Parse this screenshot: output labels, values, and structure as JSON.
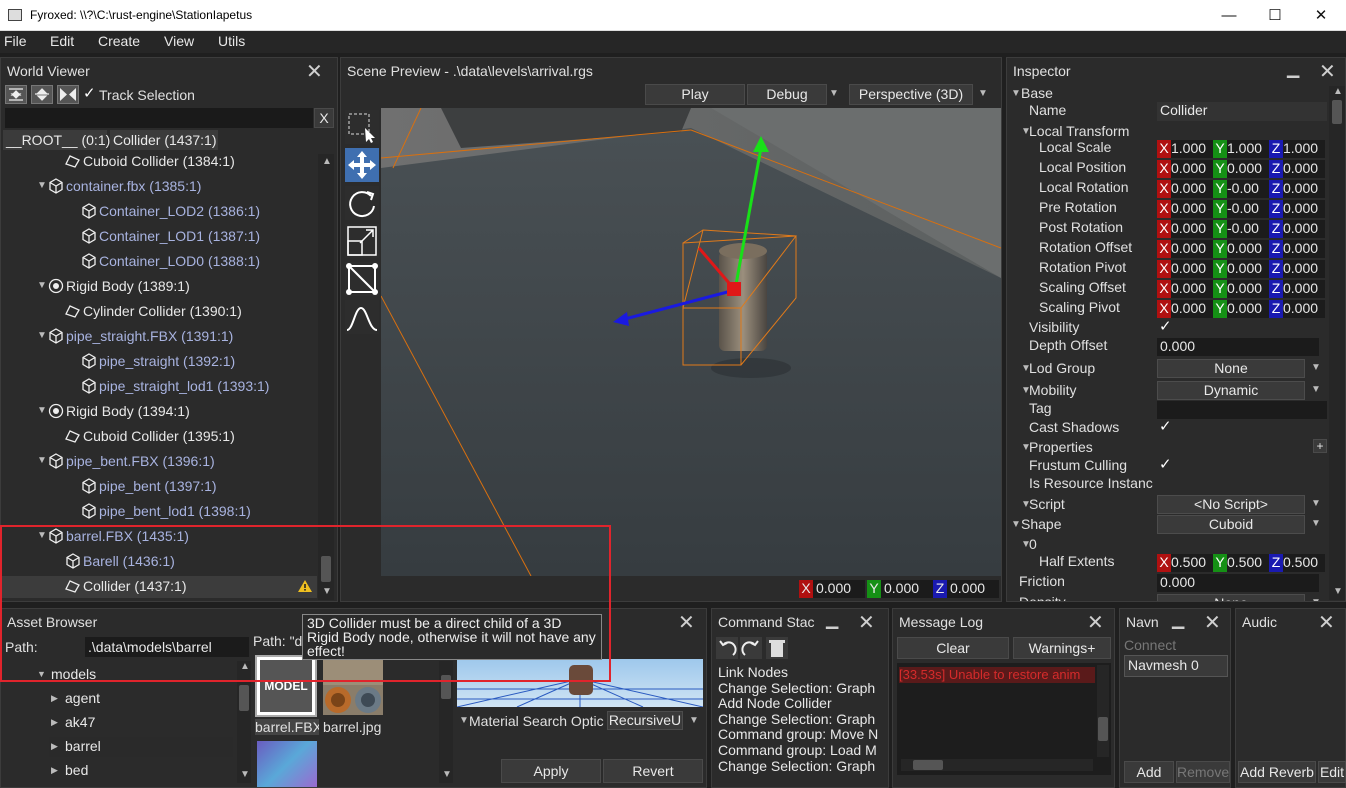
{
  "window": {
    "title": "Fyroxed: \\\\?\\C:\\rust-engine\\StationIapetus",
    "min": "—",
    "max": "☐",
    "close": "✕"
  },
  "menu": [
    "File",
    "Edit",
    "Create",
    "View",
    "Utils"
  ],
  "world_viewer": {
    "title": "World Viewer",
    "track_selection": "Track Selection",
    "clear": "X",
    "breadcrumbs": [
      "__ROOT__ (0:1)",
      "Collider (1437:1)"
    ],
    "rows": [
      {
        "text": "Cuboid Collider (1384:1)",
        "icon": "collider",
        "depth": 2,
        "color": "white"
      },
      {
        "text": "container.fbx (1385:1)",
        "icon": "model",
        "depth": 1,
        "color": "blue",
        "expand": true
      },
      {
        "text": "Container_LOD2 (1386:1)",
        "icon": "model",
        "depth": 2,
        "color": "blue"
      },
      {
        "text": "Container_LOD1 (1387:1)",
        "icon": "model",
        "depth": 2,
        "color": "blue"
      },
      {
        "text": "Container_LOD0 (1388:1)",
        "icon": "model",
        "depth": 2,
        "color": "blue"
      },
      {
        "text": "Rigid Body (1389:1)",
        "icon": "rigid",
        "depth": 1,
        "color": "white",
        "expand": true
      },
      {
        "text": "Cylinder Collider (1390:1)",
        "icon": "collider",
        "depth": 2,
        "color": "white"
      },
      {
        "text": "pipe_straight.FBX (1391:1)",
        "icon": "model",
        "depth": 1,
        "color": "blue",
        "expand": true
      },
      {
        "text": "pipe_straight (1392:1)",
        "icon": "model",
        "depth": 2,
        "color": "blue"
      },
      {
        "text": "pipe_straight_lod1 (1393:1)",
        "icon": "model",
        "depth": 2,
        "color": "blue"
      },
      {
        "text": "Rigid Body (1394:1)",
        "icon": "rigid",
        "depth": 1,
        "color": "white",
        "expand": true
      },
      {
        "text": "Cuboid Collider (1395:1)",
        "icon": "collider",
        "depth": 2,
        "color": "white"
      },
      {
        "text": "pipe_bent.FBX (1396:1)",
        "icon": "model",
        "depth": 1,
        "color": "blue",
        "expand": true
      },
      {
        "text": "pipe_bent (1397:1)",
        "icon": "model",
        "depth": 2,
        "color": "blue"
      },
      {
        "text": "pipe_bent_lod1 (1398:1)",
        "icon": "model",
        "depth": 2,
        "color": "blue"
      },
      {
        "text": "barrel.FBX (1435:1)",
        "icon": "model",
        "depth": 0,
        "color": "blue",
        "expand": true
      },
      {
        "text": "Barell (1436:1)",
        "icon": "model",
        "depth": 1,
        "color": "blue"
      },
      {
        "text": "Collider (1437:1)",
        "icon": "collider",
        "depth": 2,
        "color": "white",
        "selected": true,
        "warning": true
      }
    ]
  },
  "scene": {
    "title": "Scene Preview - .\\data\\levels\\arrival.rgs",
    "play": "Play",
    "debug": "Debug",
    "camera": "Perspective (3D)",
    "coords": {
      "x": "0.000",
      "y": "0.000",
      "z": "0.000"
    }
  },
  "inspector": {
    "title": "Inspector",
    "base": "Base",
    "name_label": "Name",
    "name_value": "Collider",
    "local_transform": "Local Transform",
    "vec_rows": [
      {
        "label": "Local Scale",
        "x": "1.000",
        "y": "1.000",
        "z": "1.000"
      },
      {
        "label": "Local Position",
        "x": "0.000",
        "y": "0.000",
        "z": "0.000"
      },
      {
        "label": "Local Rotation",
        "x": "0.000",
        "y": "-0.00",
        "z": "0.000"
      },
      {
        "label": "Pre Rotation",
        "x": "0.000",
        "y": "-0.00",
        "z": "0.000"
      },
      {
        "label": "Post Rotation",
        "x": "0.000",
        "y": "-0.00",
        "z": "0.000"
      },
      {
        "label": "Rotation Offset",
        "x": "0.000",
        "y": "0.000",
        "z": "0.000"
      },
      {
        "label": "Rotation Pivot",
        "x": "0.000",
        "y": "0.000",
        "z": "0.000"
      },
      {
        "label": "Scaling Offset",
        "x": "0.000",
        "y": "0.000",
        "z": "0.000"
      },
      {
        "label": "Scaling Pivot",
        "x": "0.000",
        "y": "0.000",
        "z": "0.000"
      }
    ],
    "visibility": "Visibility",
    "depth_offset": "Depth Offset",
    "depth_offset_value": "0.000",
    "lod_group": "Lod Group",
    "lod_value": "None",
    "mobility": "Mobility",
    "mobility_value": "Dynamic",
    "tag": "Tag",
    "cast_shadows": "Cast Shadows",
    "properties": "Properties",
    "frustum_culling": "Frustum Culling",
    "is_resource": "Is Resource Instanc",
    "script": "Script",
    "script_value": "<No Script>",
    "shape": "Shape",
    "shape_value": "Cuboid",
    "shape_index": "0",
    "half_extents": "Half Extents",
    "he": {
      "x": "0.500",
      "y": "0.500",
      "z": "0.500"
    },
    "friction": "Friction",
    "friction_value": "0.000",
    "density_value": "None",
    "density": "Density"
  },
  "asset_browser": {
    "title": "Asset Browser",
    "path_label": "Path:",
    "path_value": ".\\data\\models\\barrel",
    "path2_label": "Path: \"da",
    "folders": [
      {
        "name": "models",
        "open": true,
        "depth": 0
      },
      {
        "name": "agent",
        "depth": 1
      },
      {
        "name": "ak47",
        "depth": 1
      },
      {
        "name": "barrel",
        "depth": 1,
        "selected": true
      },
      {
        "name": "bed",
        "depth": 1
      }
    ],
    "files": [
      "barrel.FBX",
      "barrel.jpg"
    ],
    "model_badge": "MODEL",
    "material_search": "Material Search Optic",
    "material_search_value": "RecursiveU",
    "apply": "Apply",
    "revert": "Revert",
    "tooltip": "3D Collider must be a direct child of a 3D Rigid Body node, otherwise it will not have any effect!"
  },
  "command_stack": {
    "title": "Command Stac",
    "items": [
      "Link Nodes",
      "Change Selection: Graph",
      "Add Node Collider",
      "Change Selection: Graph",
      "Command group: Move N",
      "Command group: Load M",
      "Change Selection: Graph"
    ]
  },
  "message_log": {
    "title": "Message Log",
    "clear": "Clear",
    "warnings": "Warnings+",
    "message": "[33.53s] Unable to restore anim"
  },
  "navmesh": {
    "title": "Navn",
    "connect": "Connect",
    "item": "Navmesh 0",
    "add": "Add",
    "remove": "Remove"
  },
  "audio": {
    "title": "Audic",
    "add_reverb": "Add Reverb",
    "edit": "Edit"
  },
  "colors": {
    "accent_red": "#e0242c",
    "selection_blue": "#a8b3e0"
  }
}
